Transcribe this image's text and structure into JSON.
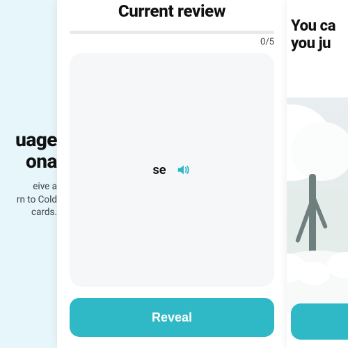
{
  "colors": {
    "accent": "#2fb8c6",
    "card_bg": "#f6f7f9",
    "panel1_bg": "#e7f6fb"
  },
  "panel1": {
    "title_line1": "uage",
    "title_line2": "ona",
    "desc_line1": "eive a",
    "desc_line2": "rn to Cold",
    "desc_line3": "cards."
  },
  "panel2": {
    "title": "Current review",
    "progress": {
      "done": 0,
      "total": 5,
      "label": "0/5"
    },
    "card": {
      "word": "se",
      "audio_icon": "speaker-icon"
    },
    "reveal_label": "Reveal"
  },
  "panel3": {
    "title_line1": "You ca",
    "title_line2": "you ju"
  }
}
